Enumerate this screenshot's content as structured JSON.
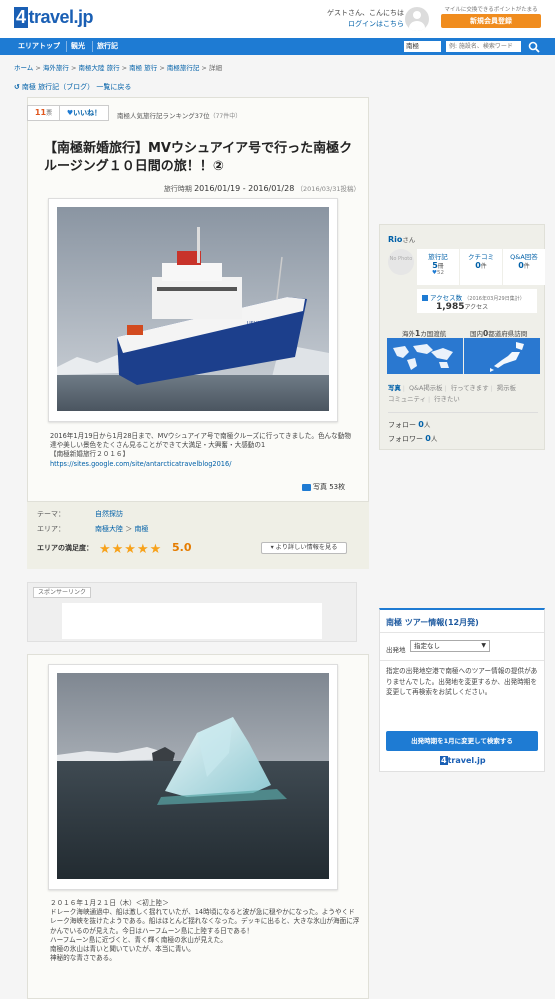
{
  "header": {
    "logo_text": "travel.jp",
    "logo_mark": "4",
    "guest_greeting": "ゲストさん、こんにちは",
    "login_link": "ログインはこちら",
    "mile_note": "マイルに交換できるポイントがたまる",
    "register_label": "新規会員登録"
  },
  "nav": {
    "items": [
      "エリアトップ",
      "観光",
      "旅行記"
    ],
    "region_value": "南極",
    "search_placeholder": "例: 施設名、検索ワード"
  },
  "breadcrumb": [
    "ホーム",
    "海外旅行",
    "南極大陸 旅行",
    "南極 旅行",
    "南極旅行記",
    "詳細"
  ],
  "back_link": "南極 旅行記（ブログ） 一覧に戻る",
  "vote": {
    "count": "11",
    "unit": "票",
    "like_label": "いいね！"
  },
  "ranking_text": "南極人気旅行記ランキング37位",
  "ranking_sub": "（77件中）",
  "travelogue": {
    "title": "【南極新婚旅行】MVウシュアイア号で行った南極クルージング１０日間の旅！！②",
    "period_label": "旅行時期",
    "period": "2016/01/19 - 2016/01/28",
    "posted": "（2016/03/31投稿）",
    "description": [
      "2016年1月19日から1月28日まで、MVウシュアイア号で南極クルーズに行ってきました。色んな動物達や美しい景色をたくさん見ることができて大満足・大興奮・大感動の1",
      "【南極新婚旅行２０１６】",
      "https://sites.google.com/site/antarcticatravelblog2016/"
    ],
    "photo_count": "写真 53枚"
  },
  "meta": {
    "theme_label": "テーマ：",
    "theme_value": "自然探訪",
    "area_label": "エリア：",
    "area_values": [
      "南極大陸",
      "南極"
    ],
    "satisfaction_label": "エリアの満足度：",
    "stars": "★★★★★",
    "score": "5.0",
    "detail_button": "より詳しい情報を見る"
  },
  "sponsor_label": "スポンサーリンク",
  "day_entry": [
    "２０１６年１月２１日（木）＜初上陸＞",
    "ドレーク海峡通過中、船は激しく揺れていたが、14時頃になると波が急に穏やかになった。ようやくドレーク海峡を抜けたようである。船はほとんど揺れなくなった。デッキに出ると、大きな氷山が海面に浮かんでいるのが見えた。今日はハーフムーン島に上陸する日である！",
    "ハーフムーン島に近づくと、青く輝く南極の氷山が見えた。",
    "南極の氷山は青いと聞いていたが、本当に青い。",
    "神秘的な青さである。"
  ],
  "user": {
    "name": "Rio",
    "honorific": "さん",
    "no_photo": "No Photo",
    "stats": [
      {
        "label": "旅行記",
        "value": "5",
        "unit": "冊",
        "likes": "52"
      },
      {
        "label": "クチコミ",
        "value": "0",
        "unit": "件"
      },
      {
        "label": "Q&A回答",
        "value": "0",
        "unit": "件"
      }
    ],
    "access_label": "アクセス数",
    "access_date": "（2016年03月29日集計）",
    "access_count": "1,985",
    "access_unit": "アクセス",
    "overseas_label_pre": "海外",
    "overseas_count": "1",
    "overseas_label_post": "カ国渡航",
    "domestic_label_pre": "国内",
    "domestic_count": "0",
    "domestic_label_post": "都道府県訪問",
    "links": [
      "写真",
      "Q&A掲示板",
      "行ってきます",
      "掲示板",
      "コミュニティ",
      "行きたい"
    ],
    "follow_label": "フォロー",
    "follow_count": "0",
    "follower_label": "フォロワー",
    "follower_count": "0",
    "person_unit": "人"
  },
  "tour": {
    "heading": "南極 ツアー情報(12月発)",
    "departure_label": "出発地",
    "departure_value": "指定なし",
    "message": "指定の出発地空港で南極へのツアー情報の提供がありませんでした。出発地を変更するか、出発時期を変更して再検索をお試しください。",
    "button": "出発時期を1月に変更して検索する",
    "logo_text": "travel.jp",
    "logo_mark": "4"
  },
  "colors": {
    "brand_blue": "#1e7bd3",
    "accent_orange": "#f08c1e",
    "star": "#f7a21b"
  }
}
